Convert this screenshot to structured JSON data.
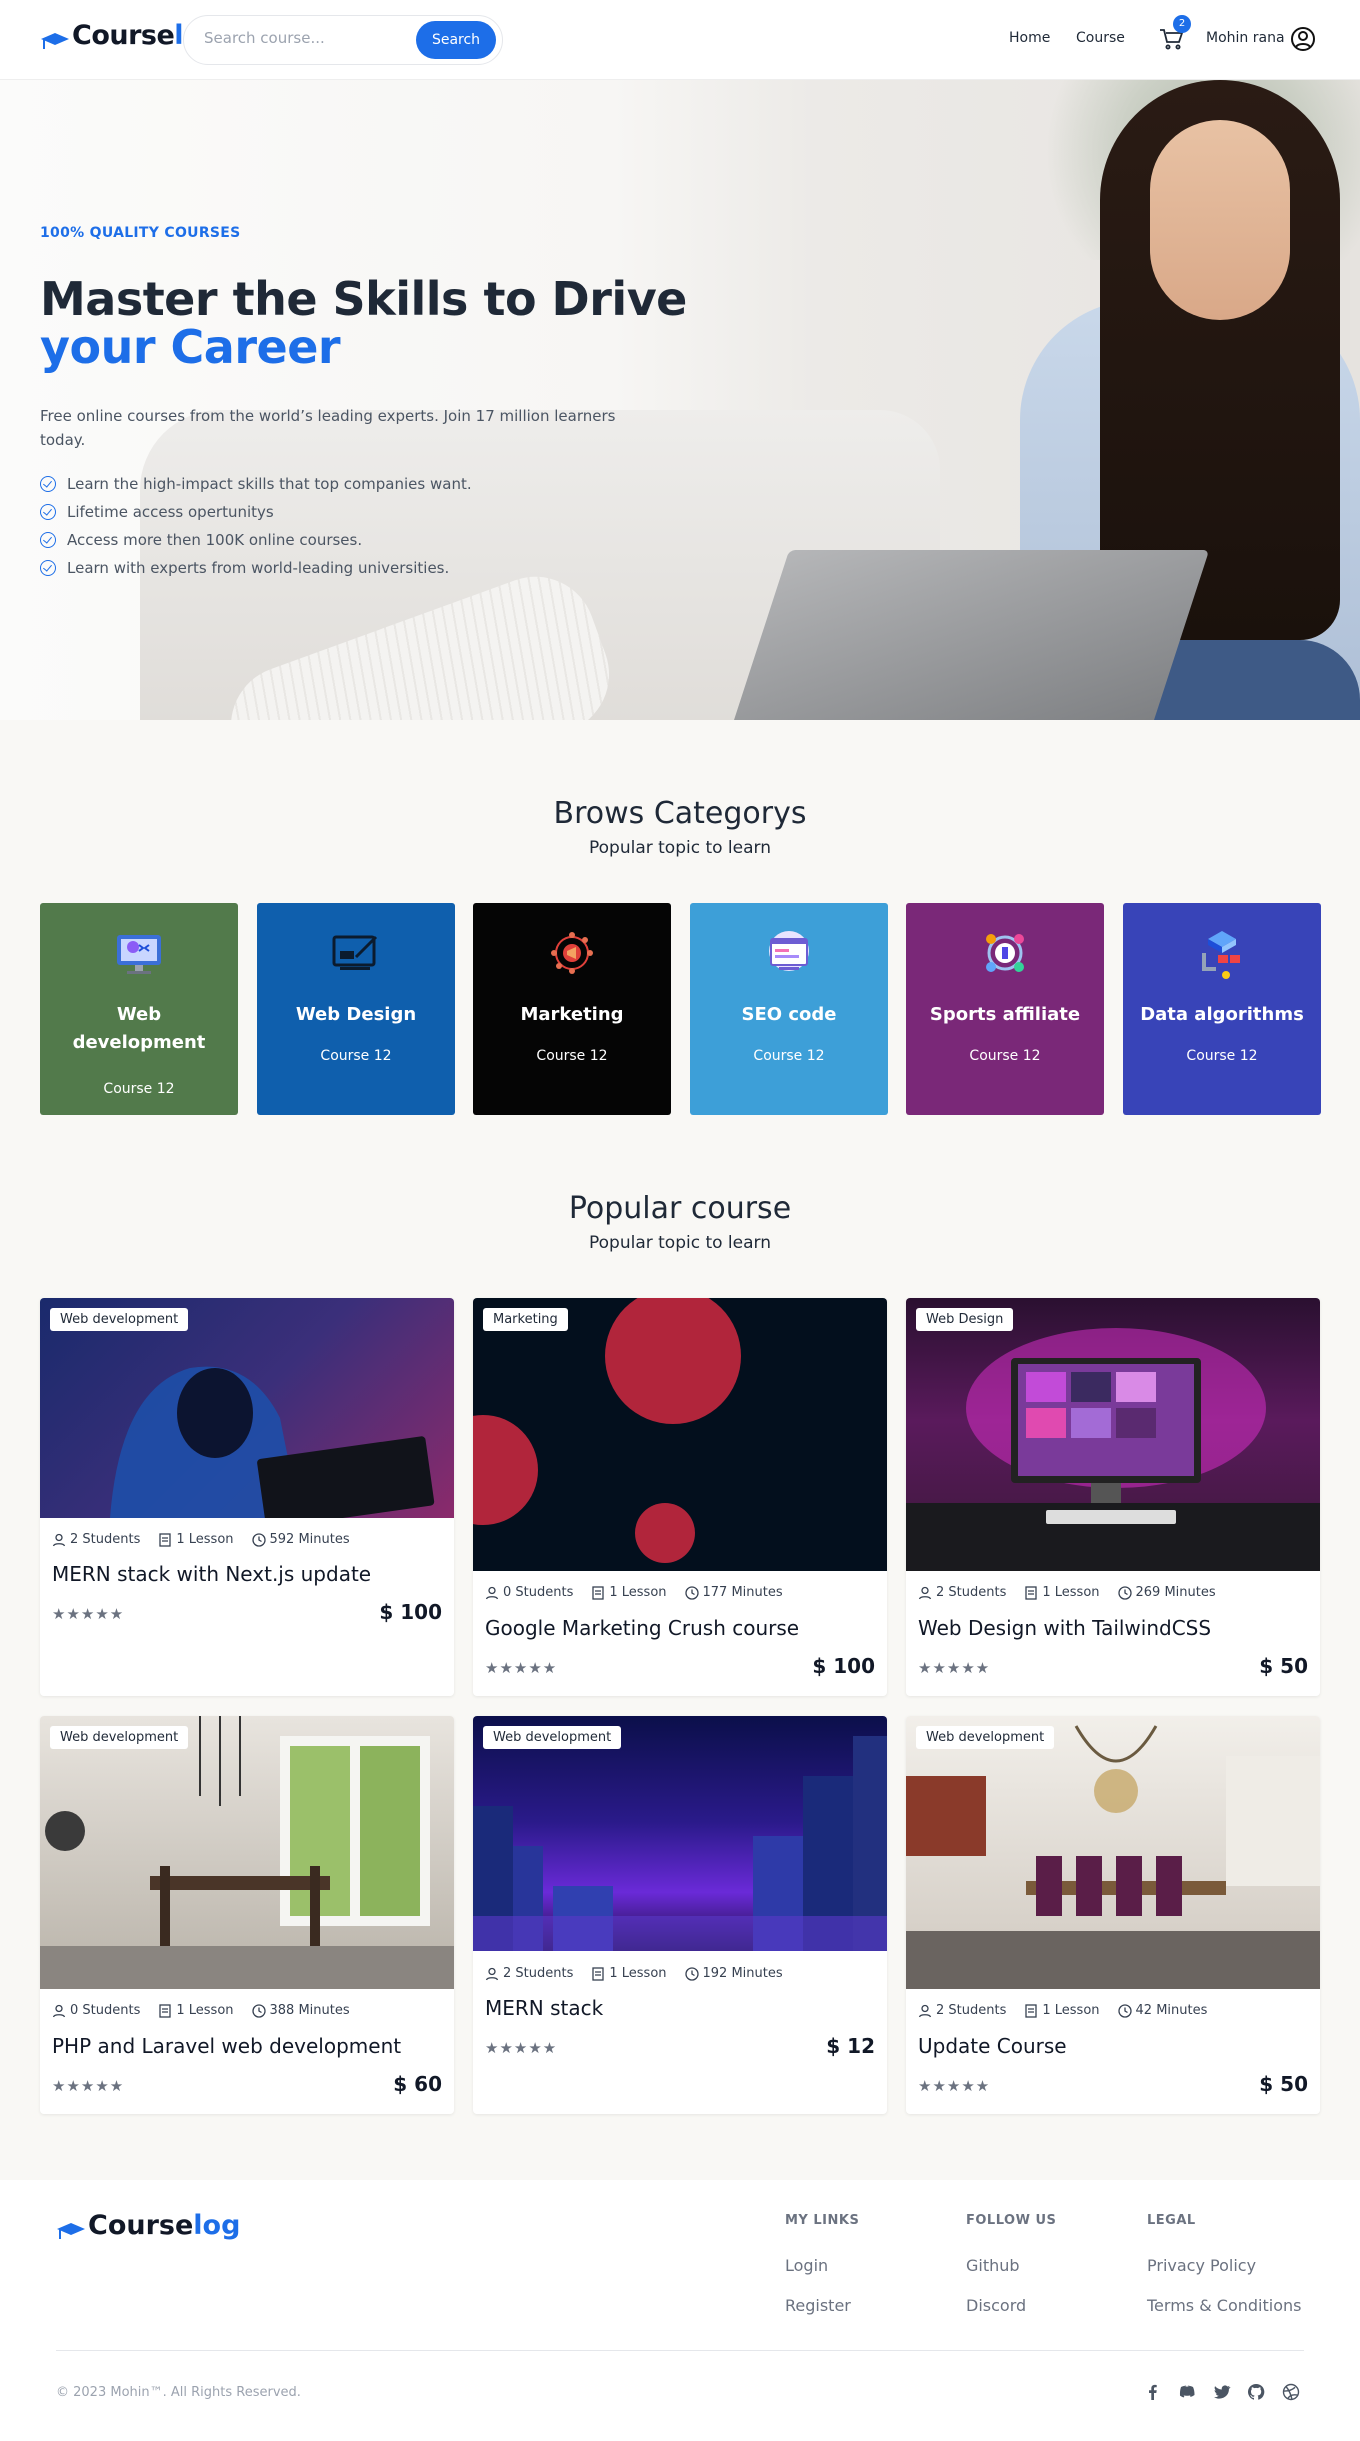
{
  "header": {
    "brand_part1": "Course",
    "brand_part2": "log",
    "search_placeholder": "Search course...",
    "search_button": "Search",
    "nav": [
      "Home",
      "Course"
    ],
    "cart_count": "2",
    "user_name": "Mohin rana",
    "accent": "#1d6ee8"
  },
  "hero": {
    "kicker": "100% QUALITY COURSES",
    "title_line1": "Master the Skills to Drive",
    "title_line2": "your Career",
    "lead": "Free online courses from the world’s leading experts. Join 17 million learners today.",
    "features": [
      "Learn the high-impact skills that top companies want.",
      "Lifetime access opertunitys",
      "Access more then 100K online courses.",
      "Learn with experts from world-leading universities."
    ]
  },
  "categories": {
    "title": "Brows Categorys",
    "subtitle": "Popular topic to learn",
    "items": [
      {
        "name": "Web development",
        "count": "Course 12",
        "color": "#527a4b",
        "icon": "monitor-code-icon"
      },
      {
        "name": "Web Design",
        "count": "Course 12",
        "color": "#0f5fad",
        "icon": "design-screen-icon"
      },
      {
        "name": "Marketing",
        "count": "Course 12",
        "color": "#050505",
        "icon": "megaphone-network-icon"
      },
      {
        "name": "SEO code",
        "count": "Course 12",
        "color": "#3d9fd8",
        "icon": "seo-browser-icon"
      },
      {
        "name": "Sports affiliate",
        "count": "Course 12",
        "color": "#7a2878",
        "icon": "affiliate-network-icon"
      },
      {
        "name": "Data algorithms",
        "count": "Course 12",
        "color": "#3844b8",
        "icon": "algorithm-flow-icon"
      }
    ]
  },
  "popular": {
    "title": "Popular course",
    "subtitle": "Popular topic to learn",
    "courses": [
      {
        "tag": "Web development",
        "students": "2 Students",
        "lessons": "1 Lesson",
        "minutes": "592 Minutes",
        "title": "MERN stack with Next.js update",
        "rating": "★★★★★",
        "price": "$ 100"
      },
      {
        "tag": "Marketing",
        "students": "0 Students",
        "lessons": "1 Lesson",
        "minutes": "177 Minutes",
        "title": "Google Marketing Crush course",
        "rating": "★★★★★",
        "price": "$ 100"
      },
      {
        "tag": "Web Design",
        "students": "2 Students",
        "lessons": "1 Lesson",
        "minutes": "269 Minutes",
        "title": "Web Design with TailwindCSS",
        "rating": "★★★★★",
        "price": "$ 50"
      },
      {
        "tag": "Web development",
        "students": "0 Students",
        "lessons": "1 Lesson",
        "minutes": "388 Minutes",
        "title": "PHP and Laravel web development",
        "rating": "★★★★★",
        "price": "$ 60"
      },
      {
        "tag": "Web development",
        "students": "2 Students",
        "lessons": "1 Lesson",
        "minutes": "192 Minutes",
        "title": "MERN stack",
        "rating": "★★★★★",
        "price": "$ 12"
      },
      {
        "tag": "Web development",
        "students": "2 Students",
        "lessons": "1 Lesson",
        "minutes": "42 Minutes",
        "title": "Update Course",
        "rating": "★★★★★",
        "price": "$ 50"
      }
    ]
  },
  "footer": {
    "brand_part1": "Course",
    "brand_part2": "log",
    "col1": {
      "heading": "MY LINKS",
      "links": [
        "Login",
        "Register"
      ]
    },
    "col2": {
      "heading": "FOLLOW US",
      "links": [
        "Github",
        "Discord"
      ]
    },
    "col3": {
      "heading": "LEGAL",
      "links": [
        "Privacy Policy",
        "Terms & Conditions"
      ]
    },
    "copyright": "© 2023 Mohin™. All Rights Reserved.",
    "social_icons": [
      "facebook-icon",
      "discord-icon",
      "twitter-icon",
      "github-icon",
      "dribbble-icon"
    ]
  }
}
